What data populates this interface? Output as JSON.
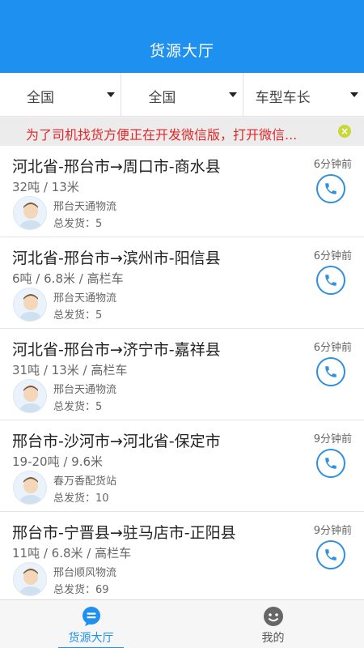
{
  "header": {
    "title": "货源大厅"
  },
  "filters": [
    {
      "label": "全国"
    },
    {
      "label": "全国"
    },
    {
      "label": "车型车长"
    }
  ],
  "notice": {
    "text": "为了司机找货方便正在开发微信版，打开微信..."
  },
  "listings": [
    {
      "route": "河北省-邢台市→周口市-商水县",
      "spec": "32吨 / 13米",
      "company": "邢台天通物流",
      "total": "总发货：5",
      "time": "6分钟前"
    },
    {
      "route": "河北省-邢台市→滨州市-阳信县",
      "spec": "6吨 / 6.8米 / 高栏车",
      "company": "邢台天通物流",
      "total": "总发货：5",
      "time": "6分钟前"
    },
    {
      "route": "河北省-邢台市→济宁市-嘉祥县",
      "spec": "31吨 / 13米 / 高栏车",
      "company": "邢台天通物流",
      "total": "总发货：5",
      "time": "6分钟前"
    },
    {
      "route": "邢台市-沙河市→河北省-保定市",
      "spec": "19-20吨 / 9.6米",
      "company": "春万香配货站",
      "total": "总发货：10",
      "time": "9分钟前"
    },
    {
      "route": "邢台市-宁晋县→驻马店市-正阳县",
      "spec": "11吨 / 6.8米 / 高栏车",
      "company": "邢台顺风物流",
      "total": "总发货：69",
      "time": "9分钟前"
    }
  ],
  "tabbar": [
    {
      "label": "货源大厅",
      "icon": "cargo-hall-icon"
    },
    {
      "label": "我的",
      "icon": "profile-icon"
    }
  ],
  "colors": {
    "primary": "#1e90f0",
    "notice": "#e5282a"
  }
}
